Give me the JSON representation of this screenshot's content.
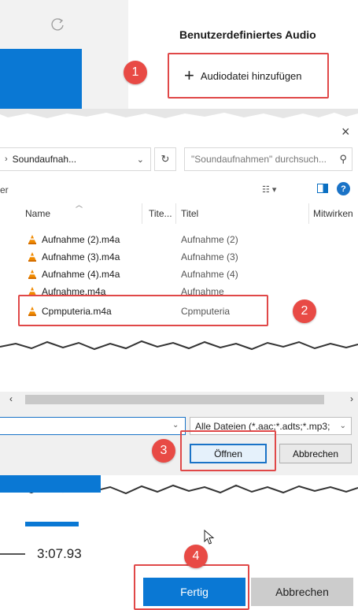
{
  "panel1": {
    "title": "Benutzerdefiniertes Audio",
    "add_button_label": "Audiodatei hinzufügen",
    "add_button_icon": "plus-icon",
    "step": "1"
  },
  "panel2": {
    "close_glyph": "×",
    "breadcrumb": "Soundaufnah...",
    "search_placeholder": "\"Soundaufnahmen\" durchsuch...",
    "toolbar_label": "er",
    "help_glyph": "?",
    "columns": [
      "Name",
      "Tite...",
      "Titel",
      "Mitwirken"
    ],
    "files": [
      {
        "name": "Aufnahme (2).m4a",
        "title": "Aufnahme (2)"
      },
      {
        "name": "Aufnahme (3).m4a",
        "title": "Aufnahme (3)"
      },
      {
        "name": "Aufnahme (4).m4a",
        "title": "Aufnahme (4)"
      },
      {
        "name": "Aufnahme.m4a",
        "title": "Aufnahme"
      },
      {
        "name": "Cpmputeria.m4a",
        "title": "Cpmputeria"
      }
    ],
    "file_icon": "vlc-cone-icon",
    "step": "2"
  },
  "panel3": {
    "filter_value": "Alle Dateien (*.aac;*.adts;*.mp3;",
    "open_label": "Öffnen",
    "cancel_label": "Abbrechen",
    "step": "3"
  },
  "panel4": {
    "time": "3:07.93",
    "done_label": "Fertig",
    "cancel_label": "Abbrechen",
    "step": "4"
  },
  "colors": {
    "accent": "#0a78d4",
    "highlight_red": "#e04848",
    "badge_red": "#e84a45"
  }
}
